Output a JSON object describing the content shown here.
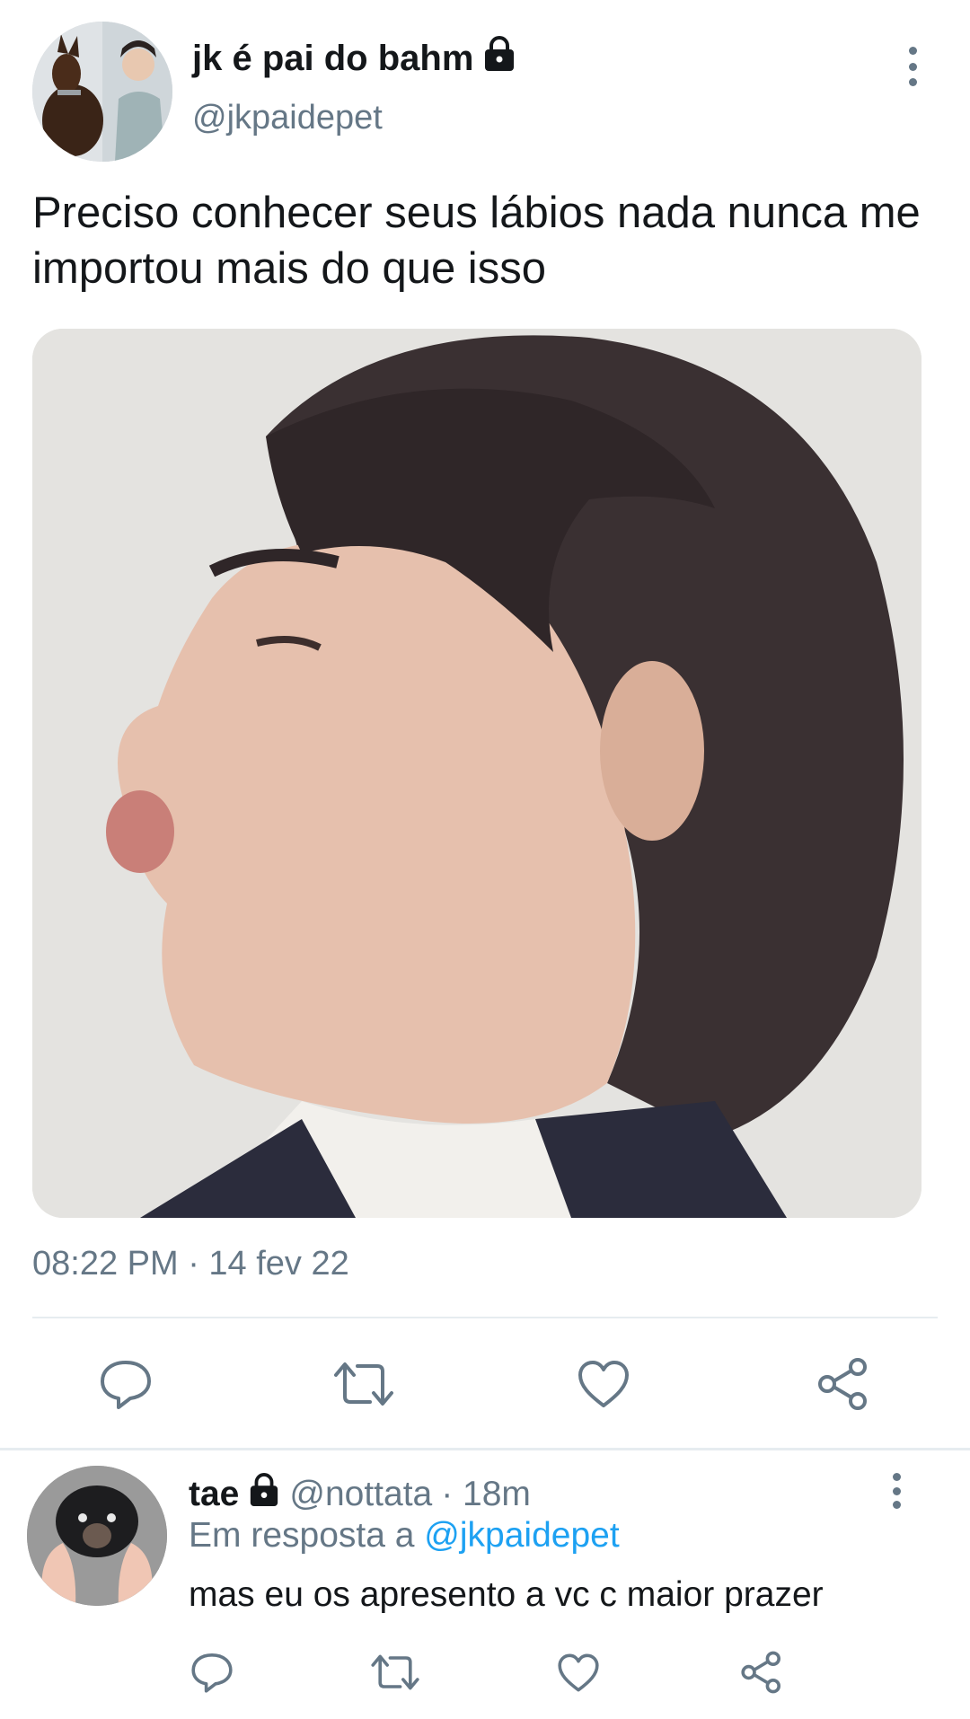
{
  "tweet": {
    "author": {
      "display_name": "jk é pai do bahm",
      "handle": "@jkpaidepet",
      "protected_icon": "lock-icon",
      "avatar": "avatar-image"
    },
    "text": "Preciso conhecer seus lábios nada nunca me importou mais do que isso",
    "media": "photo",
    "timestamp": "08:22 PM · 14 fev 22",
    "actions": [
      "reply-icon",
      "retweet-icon",
      "like-icon",
      "share-icon"
    ],
    "more_icon": "more-vertical-icon"
  },
  "reply": {
    "author": {
      "display_name": "tae",
      "handle": "@nottata",
      "time": "· 18m",
      "protected_icon": "lock-icon",
      "avatar": "avatar-image"
    },
    "in_reply_to_prefix": "Em resposta a",
    "in_reply_to_handle": "@jkpaidepet",
    "text": "mas eu os apresento a vc c maior prazer",
    "actions": [
      "reply-icon",
      "retweet-icon",
      "like-icon",
      "share-icon"
    ],
    "more_icon": "more-vertical-icon"
  },
  "colors": {
    "text_primary": "#14171a",
    "text_secondary": "#657786",
    "link": "#1da1f2",
    "divider": "#e6ecf0"
  }
}
